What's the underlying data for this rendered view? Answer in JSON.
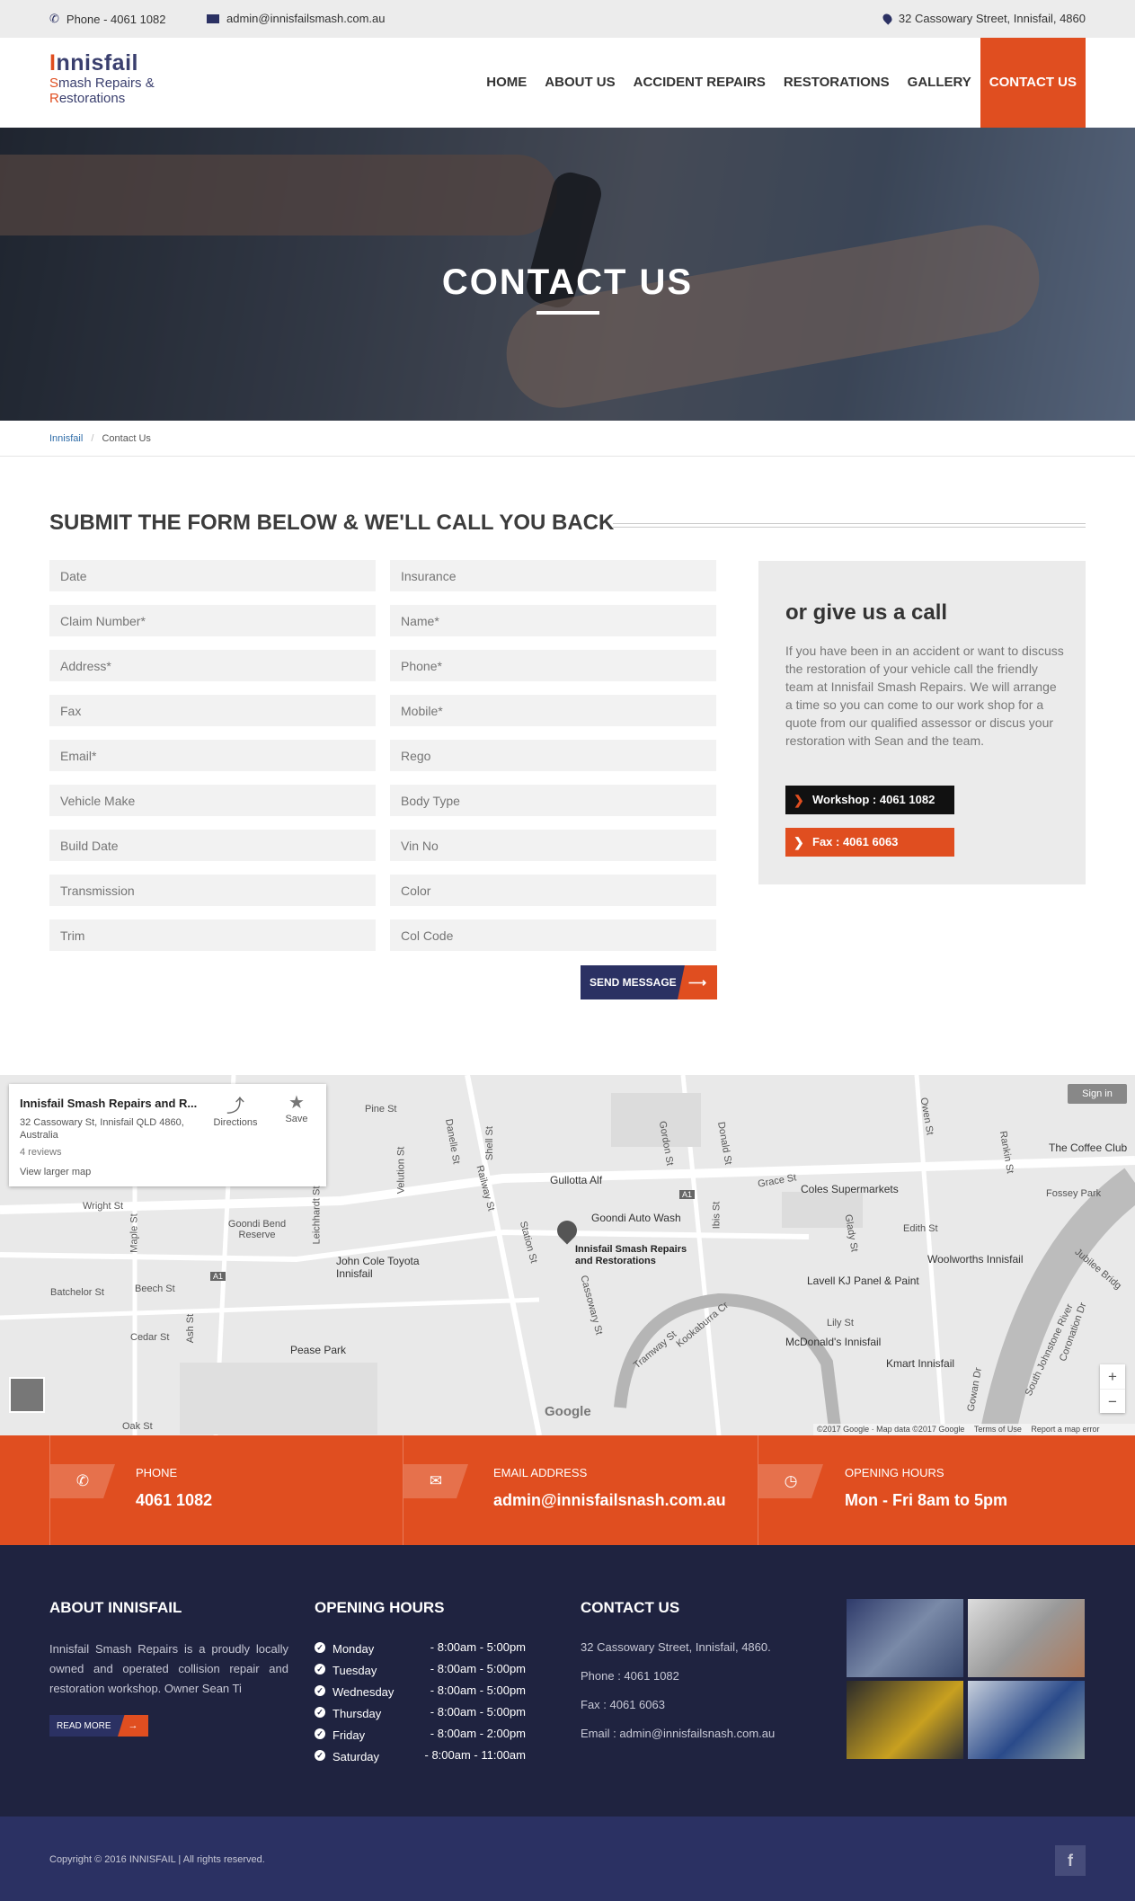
{
  "topbar": {
    "phone": "Phone - 4061 1082",
    "email": "admin@innisfailsmash.com.au",
    "address": "32 Cassowary Street, Innisfail, 4860"
  },
  "logo": {
    "line1_first": "I",
    "line1_rest": "nnisfail",
    "line2_first": "S",
    "line2_rest": "mash Repairs &",
    "line3_first": "R",
    "line3_rest": "estorations"
  },
  "nav": [
    {
      "label": "HOME"
    },
    {
      "label": "ABOUT US"
    },
    {
      "label": "ACCIDENT REPAIRS"
    },
    {
      "label": "RESTORATIONS"
    },
    {
      "label": "GALLERY"
    },
    {
      "label": "CONTACT US",
      "active": true
    }
  ],
  "hero": {
    "title": "CONTACT US"
  },
  "breadcrumb": {
    "home": "Innisfail",
    "sep": "/",
    "current": "Contact Us"
  },
  "form": {
    "title": "SUBMIT THE FORM BELOW & WE'LL CALL YOU BACK",
    "fields_left": [
      "Date",
      "Claim Number*",
      "Address*",
      "Fax",
      "Email*",
      "Vehicle Make",
      "Build Date",
      "Transmission",
      "Trim"
    ],
    "fields_right": [
      "Insurance",
      "Name*",
      "Phone*",
      "Mobile*",
      "Rego",
      "Body Type",
      "Vin No",
      "Color",
      "Col Code"
    ],
    "send_label": "SEND MESSAGE",
    "send_arrow": "⟶"
  },
  "callbox": {
    "title": "or give us a call",
    "text": "If you have been in an accident or want to discuss the restoration of your vehicle call the friendly team at Innisfail Smash Repairs. We will arrange a time so you can come to our work shop for a quote from our qualified assessor or discus your restoration with Sean and the team.",
    "workshop": "Workshop : 4061 1082",
    "fax": "Fax : 4061 6063"
  },
  "map": {
    "card_title": "Innisfail Smash Repairs and R...",
    "card_address": "32 Cassowary St, Innisfail QLD 4860, Australia",
    "card_reviews": "4 reviews",
    "card_larger": "View larger map",
    "directions": "Directions",
    "save": "Save",
    "signin": "Sign in",
    "pin_label_1": "Innisfail Smash Repairs",
    "pin_label_2": "and Restorations",
    "attribution": "©2017 Google · Map data ©2017 Google",
    "terms": "Terms of Use",
    "report": "Report a map error",
    "google": "Google",
    "zoom_in": "+",
    "zoom_out": "−",
    "streets": [
      "Pine St",
      "Wright St",
      "Maple St",
      "Batchelor St",
      "Beech St",
      "Cedar St",
      "Ash St",
      "Oak St",
      "Leichhardt St",
      "Velution St",
      "Danelle St",
      "Shell St",
      "Railway St",
      "Station St",
      "Cassowary St",
      "Tramway St",
      "Kookaburra Cr",
      "Ibis St",
      "Gordon St",
      "Donald St",
      "Grace St",
      "Owen St",
      "Rankin St",
      "Edith St",
      "Glady St",
      "Lily St",
      "Gowan Dr",
      "Coronation Dr",
      "Jubilee Bridg",
      "South Johnstone River",
      "Fossey Park",
      "Goondi Bend Reserve"
    ],
    "places": [
      "Gullotta Alf",
      "Goondi Auto Wash",
      "John Cole Toyota Innisfail",
      "Pease Park",
      "Coles Supermarkets",
      "Woolworths Innisfail",
      "Lavell KJ Panel & Paint",
      "McDonald's Innisfail",
      "Kmart Innisfail",
      "The Coffee Club"
    ],
    "route_a1": "A1"
  },
  "strip": [
    {
      "label": "PHONE",
      "value": "4061 1082",
      "icon": "phone-icon"
    },
    {
      "label": "EMAIL ADDRESS",
      "value": "admin@innisfailsnash.com.au",
      "icon": "envelope-icon"
    },
    {
      "label": "OPENING HOURS",
      "value": "Mon - Fri 8am to 5pm",
      "icon": "clock-icon"
    }
  ],
  "footer": {
    "about_title": "ABOUT INNISFAIL",
    "about_text": "Innisfail Smash Repairs is a proudly locally owned and operated collision repair and restoration workshop. Owner Sean Ti",
    "read_more": "READ MORE",
    "read_arrow": "→",
    "hours_title": "OPENING HOURS",
    "hours": [
      {
        "day": "Monday",
        "time": "- 8:00am - 5:00pm"
      },
      {
        "day": "Tuesday",
        "time": "- 8:00am - 5:00pm"
      },
      {
        "day": "Wednesday",
        "time": "- 8:00am - 5:00pm"
      },
      {
        "day": "Thursday",
        "time": "- 8:00am - 5:00pm"
      },
      {
        "day": "Friday",
        "time": "- 8:00am - 2:00pm"
      },
      {
        "day": "Saturday",
        "time": "- 8:00am - 11:00am"
      }
    ],
    "contact_title": "CONTACT US",
    "contact_address": "32 Cassowary Street, Innisfail, 4860.",
    "contact_phone": "Phone : 4061 1082",
    "contact_fax": "Fax : 4061 6063",
    "contact_email": "Email : admin@innisfailsnash.com.au",
    "copyright": "Copyright © 2016 INNISFAIL | All rights reserved.",
    "facebook": "f"
  },
  "colors": {
    "accent": "#e04e20",
    "navy": "#2b3163",
    "footer": "#1f2340"
  }
}
